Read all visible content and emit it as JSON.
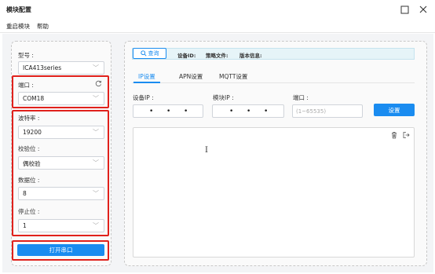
{
  "window": {
    "title": "模块配置"
  },
  "menu": {
    "items": [
      "重启模块",
      "帮助"
    ]
  },
  "left": {
    "model": {
      "label": "型号 :",
      "value": "ICA413series"
    },
    "port": {
      "label": "端口 :",
      "value": "COM18"
    },
    "baud": {
      "label": "波特率 :",
      "value": "19200"
    },
    "parity": {
      "label": "校验位 :",
      "value": "偶校验"
    },
    "databits": {
      "label": "数据位 :",
      "value": "8"
    },
    "stopbits": {
      "label": "停止位 :",
      "value": "1"
    },
    "open_button": "打开串口"
  },
  "info": {
    "query_button": "查询",
    "device_id": "设备ID:",
    "strategy_file": "策略文件:",
    "version": "版本信息:"
  },
  "tabs": [
    "IP设置",
    "APN设置",
    "MQTT设置"
  ],
  "ip_settings": {
    "device_ip_label": "设备IP :",
    "module_ip_label": "模块IP :",
    "port_label": "端口 :",
    "port_placeholder": "(1~65535)",
    "set_button": "设置"
  },
  "colors": {
    "accent": "#1a8cf0",
    "highlight": "#e0211c",
    "info_bg": "#e6f4f8"
  },
  "icons": {
    "minimize": "minimize-icon",
    "close": "close-icon",
    "refresh": "refresh-icon",
    "search": "search-icon",
    "trash": "trash-icon",
    "export": "export-icon"
  }
}
